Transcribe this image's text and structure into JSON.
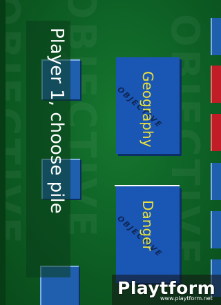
{
  "prompt": "Player 1, choose pile",
  "categories": [
    {
      "label": "Geography",
      "stamp": "OBJECTIVE"
    },
    {
      "label": "Danger",
      "stamp": "OBJECTIVE"
    }
  ],
  "watermark_text": "OBJECTIVE",
  "logo": {
    "name": "Playtform",
    "url": "www.playtform.net"
  },
  "colors": {
    "table": "#0e6226",
    "tile_blue": "#1f5fae",
    "tile_red": "#c01d26",
    "label_yellow": "#e9e040"
  }
}
